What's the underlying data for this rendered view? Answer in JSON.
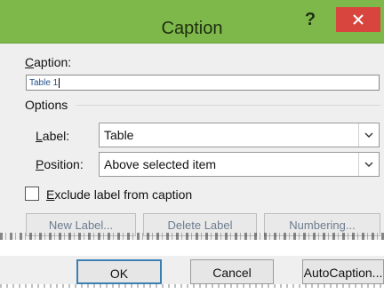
{
  "dialog": {
    "title": "Caption",
    "help_label": "?",
    "close_icon": "close-icon",
    "caption_label": "Caption:",
    "caption_value": "Table 1",
    "options_label": "Options",
    "label_label": "Label:",
    "label_value": "Table",
    "position_label": "Position:",
    "position_value": "Above selected item",
    "exclude_label": "Exclude label from caption",
    "exclude_checked": false,
    "buttons_row": {
      "new_label": "New Label...",
      "delete_label": "Delete Label",
      "numbering": "Numbering..."
    },
    "buttons": {
      "ok": "OK",
      "cancel": "Cancel",
      "autocaption": "AutoCaption..."
    },
    "colors": {
      "titlebar": "#7fb84a",
      "close": "#d8453f",
      "ok_border": "#3c7fb1"
    }
  }
}
